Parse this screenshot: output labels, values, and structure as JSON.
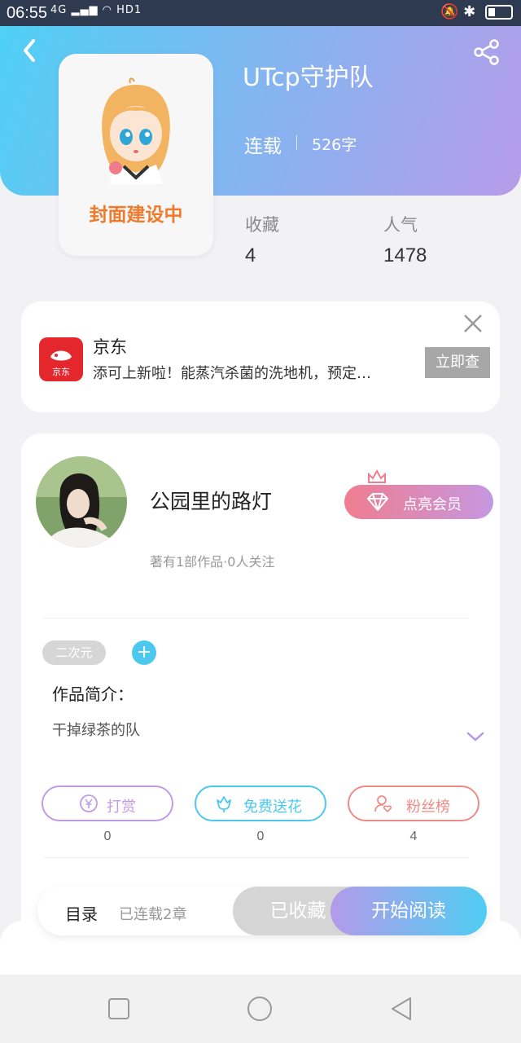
{
  "status_bar": {
    "time": "06:55",
    "network": "4G",
    "hd": "HD1"
  },
  "book": {
    "title": "UTcp守护队",
    "status": "连载",
    "words": "526字",
    "cover_text": "封面建设中",
    "stats": [
      {
        "label": "收藏",
        "value": "4"
      },
      {
        "label": "人气",
        "value": "1478"
      }
    ]
  },
  "ad": {
    "brand": "京东",
    "logo_text": "京东",
    "description": "添可上新啦！能蒸汽杀菌的洗地机，预定…",
    "button": "立即查"
  },
  "author": {
    "name": "公园里的路灯",
    "meta": "著有1部作品·0人关注",
    "vip_button": "点亮会员"
  },
  "tags": {
    "items": [
      "二次元"
    ],
    "add": "+"
  },
  "intro": {
    "label": "作品简介：",
    "text": "干掉绿茶的队"
  },
  "actions": [
    {
      "label": "打赏",
      "count": "0",
      "color": "#c19be6"
    },
    {
      "label": "免费送花",
      "count": "0",
      "color": "#4cc8ee"
    },
    {
      "label": "粉丝榜",
      "count": "4",
      "color": "#ef8a86"
    }
  ],
  "bottom_bar": {
    "toc": "目录",
    "chapters": "已连载2章",
    "collected": "已收藏",
    "read": "开始阅读"
  }
}
